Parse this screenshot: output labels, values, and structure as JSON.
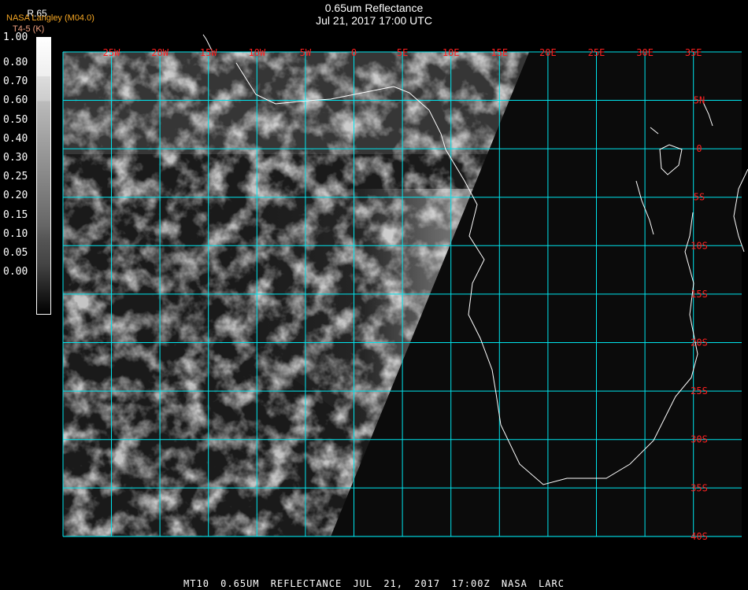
{
  "title": {
    "line1": "0.65um Reflectance",
    "line2": "Jul 21, 2017 17:00 UTC"
  },
  "legend": {
    "product": "R.65",
    "source": "NASA Langley (M04.0)",
    "unit_label": "T4-5 (K)",
    "ticks": [
      "1.00",
      "0.80",
      "0.70",
      "0.60",
      "0.50",
      "0.40",
      "0.30",
      "0.25",
      "0.20",
      "0.15",
      "0.10",
      "0.05",
      "0.00"
    ]
  },
  "map": {
    "lon_labels": [
      "25W",
      "20W",
      "15W",
      "10W",
      "5W",
      "0",
      "5E",
      "10E",
      "15E",
      "20E",
      "25E",
      "30E",
      "35E"
    ],
    "lat_labels": [
      "5N",
      "0",
      "5S",
      "10S",
      "15S",
      "20S",
      "25S",
      "30S",
      "35S",
      "40S"
    ],
    "grid_color": "#00e5ee",
    "label_color": "#ff2020"
  },
  "footer": "MT10  0.65UM REFLECTANCE   JUL 21, 2017 17:00Z   NASA LARC"
}
